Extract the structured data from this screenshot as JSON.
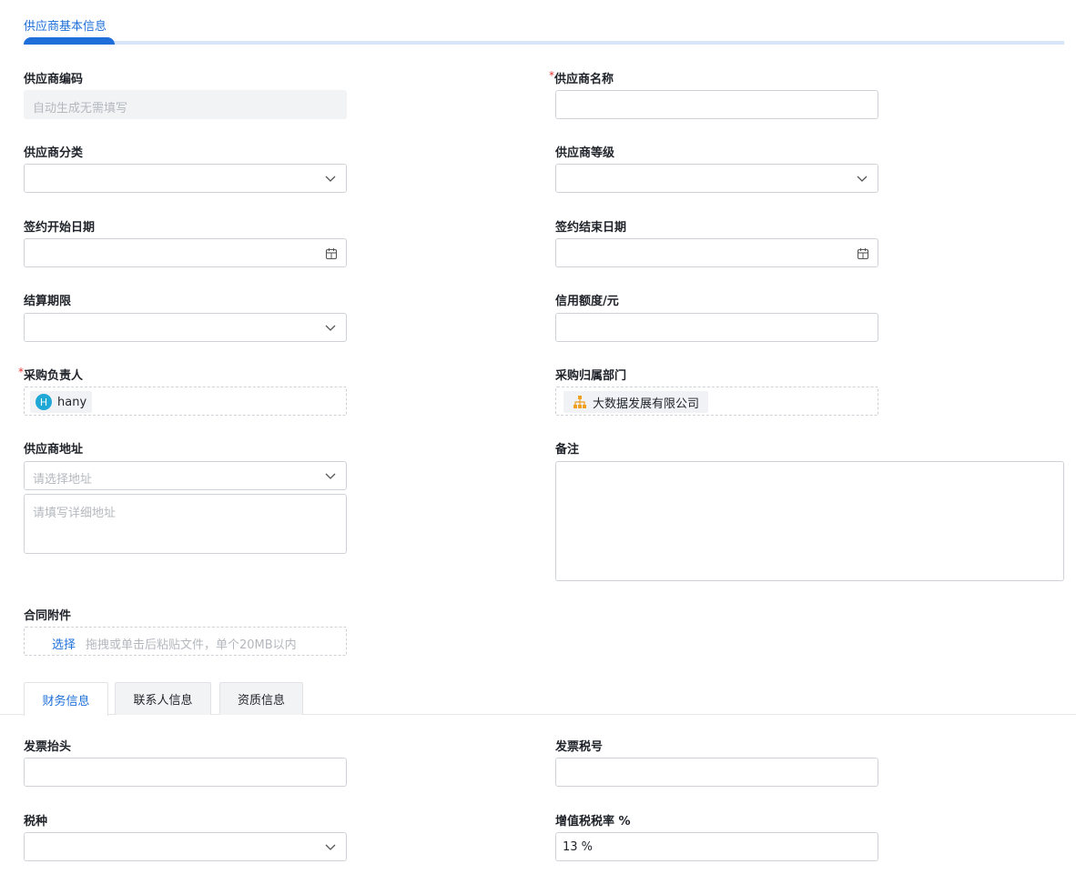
{
  "section": {
    "title": "供应商基本信息"
  },
  "form": {
    "supplier_code": {
      "label": "供应商编码",
      "placeholder": "自动生成无需填写"
    },
    "supplier_name": {
      "required_mark": "*",
      "label": "供应商名称",
      "value": ""
    },
    "supplier_category": {
      "label": "供应商分类",
      "value": ""
    },
    "supplier_level": {
      "label": "供应商等级",
      "value": ""
    },
    "contract_start": {
      "label": "签约开始日期",
      "value": ""
    },
    "contract_end": {
      "label": "签约结束日期",
      "value": ""
    },
    "settlement_term": {
      "label": "结算期限",
      "value": ""
    },
    "credit_limit": {
      "label": "信用额度/元",
      "value": ""
    },
    "purchaser": {
      "required_mark": "*",
      "label": "采购负责人",
      "avatar_letter": "H",
      "name": "hany"
    },
    "purchase_dept": {
      "label": "采购归属部门",
      "dept": "大数据发展有限公司"
    },
    "address": {
      "label": "供应商地址",
      "select_placeholder": "请选择地址",
      "detail_placeholder": "请填写详细地址"
    },
    "remarks": {
      "label": "备注",
      "value": ""
    },
    "attachment": {
      "label": "合同附件",
      "select_label": "选择",
      "hint": "拖拽或单击后粘贴文件，单个20MB以内"
    }
  },
  "tabs": [
    {
      "label": "财务信息",
      "active": true
    },
    {
      "label": "联系人信息",
      "active": false
    },
    {
      "label": "资质信息",
      "active": false
    }
  ],
  "finance": {
    "invoice_title": {
      "label": "发票抬头",
      "value": ""
    },
    "tax_number": {
      "label": "发票税号",
      "value": ""
    },
    "tax_type": {
      "label": "税种",
      "value": ""
    },
    "vat_rate": {
      "label": "增值税税率 %",
      "value": "13 %"
    }
  },
  "colors": {
    "accent": "#1e6fd9",
    "required": "#e53935",
    "avatar": "#1fa7d6",
    "org_icon": "#f0a020"
  },
  "icons": {
    "dropdown": "chevron-down-icon",
    "date": "calendar-icon",
    "dept": "org-chart-icon"
  }
}
